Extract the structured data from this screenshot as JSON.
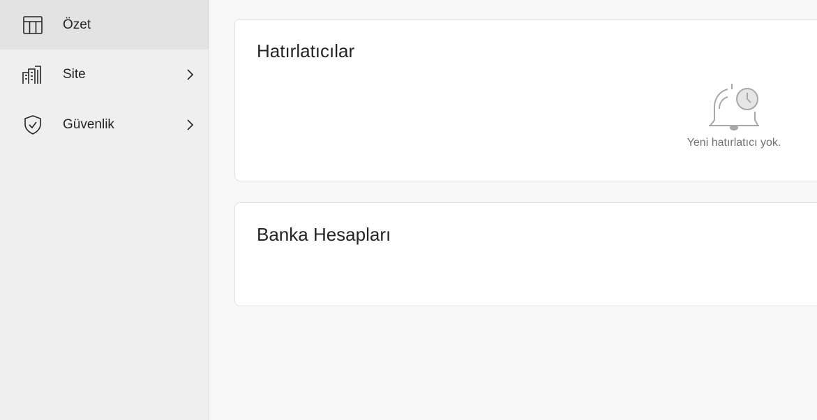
{
  "sidebar": {
    "items": [
      {
        "label": "Özet",
        "icon": "table-icon",
        "active": true,
        "has_chevron": false
      },
      {
        "label": "Site",
        "icon": "buildings-icon",
        "active": false,
        "has_chevron": true
      },
      {
        "label": "Güvenlik",
        "icon": "shield-check-icon",
        "active": false,
        "has_chevron": true
      }
    ]
  },
  "reminders": {
    "title": "Hatırlatıcılar",
    "empty_icon": "bell-clock-icon",
    "empty_text": "Yeni hatırlatıcı yok."
  },
  "bank_accounts": {
    "title": "Banka Hesapları"
  },
  "colors": {
    "sidebar_bg": "#efefef",
    "active_item_bg": "#e3e3e3",
    "page_bg": "#f8f8f8",
    "card_bg": "#ffffff",
    "muted_text": "#707070"
  }
}
